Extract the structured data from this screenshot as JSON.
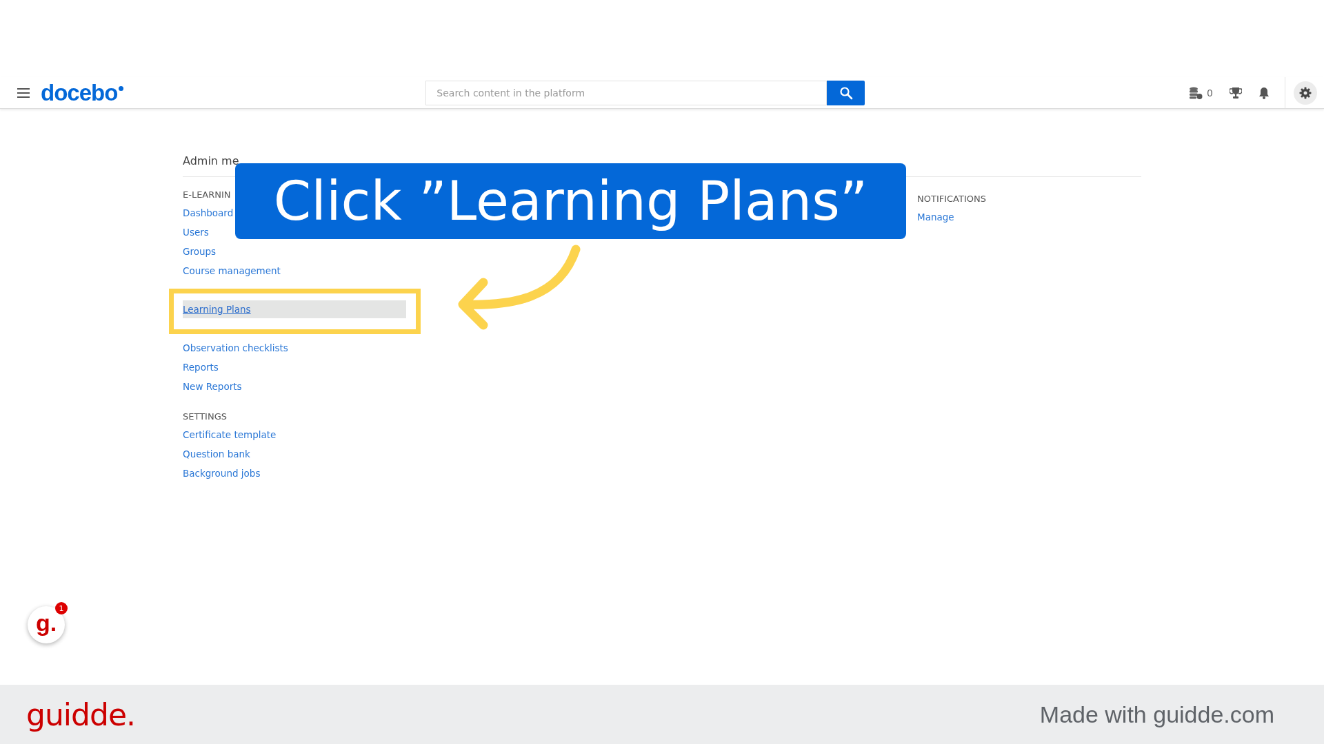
{
  "header": {
    "logo": "docebo",
    "search": {
      "placeholder": "Search content in the platform"
    },
    "credits": "0"
  },
  "admin_menu": {
    "title": "Admin me",
    "sections": [
      {
        "heading": "E-LEARNIN",
        "items": [
          {
            "kind": "link",
            "label": "Dashboard",
            "selected": false
          },
          {
            "kind": "link",
            "label": "Users",
            "selected": false
          },
          {
            "kind": "link",
            "label": "Groups",
            "selected": false
          },
          {
            "kind": "link",
            "label": "Course management",
            "selected": false
          },
          {
            "kind": "covered"
          },
          {
            "kind": "link",
            "label": "Learning Plans",
            "selected": true
          },
          {
            "kind": "covered"
          },
          {
            "kind": "link",
            "label": "Observation checklists",
            "selected": false
          },
          {
            "kind": "link",
            "label": "Reports",
            "selected": false
          },
          {
            "kind": "link",
            "label": "New Reports",
            "selected": false
          }
        ]
      },
      {
        "heading": "SETTINGS",
        "items": [
          {
            "kind": "link",
            "label": "Certificate template",
            "selected": false
          },
          {
            "kind": "link",
            "label": "Question bank",
            "selected": false
          },
          {
            "kind": "link",
            "label": "Background jobs",
            "selected": false
          }
        ]
      }
    ],
    "side_sections": [
      {
        "heading": "NOTIFICATIONS",
        "items": [
          {
            "kind": "link",
            "label": "Manage",
            "selected": false
          }
        ]
      }
    ]
  },
  "caption": "Click ”Learning Plans”",
  "widget": {
    "logo": "g.",
    "badge": "1"
  },
  "footer": {
    "logo": "guidde.",
    "credit": "Made with guidde.com"
  }
}
